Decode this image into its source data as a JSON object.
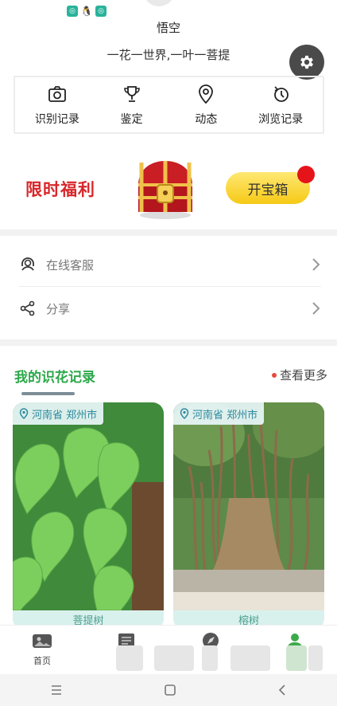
{
  "profile": {
    "name": "悟空",
    "motto": "一花一世界,一叶一菩提"
  },
  "quick_actions": [
    {
      "label": "识别记录",
      "icon": "camera-icon"
    },
    {
      "label": "鉴定",
      "icon": "trophy-icon"
    },
    {
      "label": "动态",
      "icon": "location-pin-icon"
    },
    {
      "label": "浏览记录",
      "icon": "history-icon"
    }
  ],
  "promo": {
    "title": "限时福利",
    "button": "开宝箱"
  },
  "menu": [
    {
      "label": "在线客服",
      "icon": "headset-icon"
    },
    {
      "label": "分享",
      "icon": "share-icon"
    }
  ],
  "records": {
    "title": "我的识花记录",
    "more": "查看更多",
    "items": [
      {
        "location": "河南省 郑州市",
        "name": "菩提树"
      },
      {
        "location": "河南省 郑州市",
        "name": "榕树"
      }
    ]
  },
  "bottom_nav": [
    {
      "label": "首页",
      "icon": "home-photo-icon"
    }
  ],
  "colors": {
    "accent_green": "#2ca84a",
    "promo_red": "#d8272a",
    "button_yellow": "#f6c915"
  }
}
